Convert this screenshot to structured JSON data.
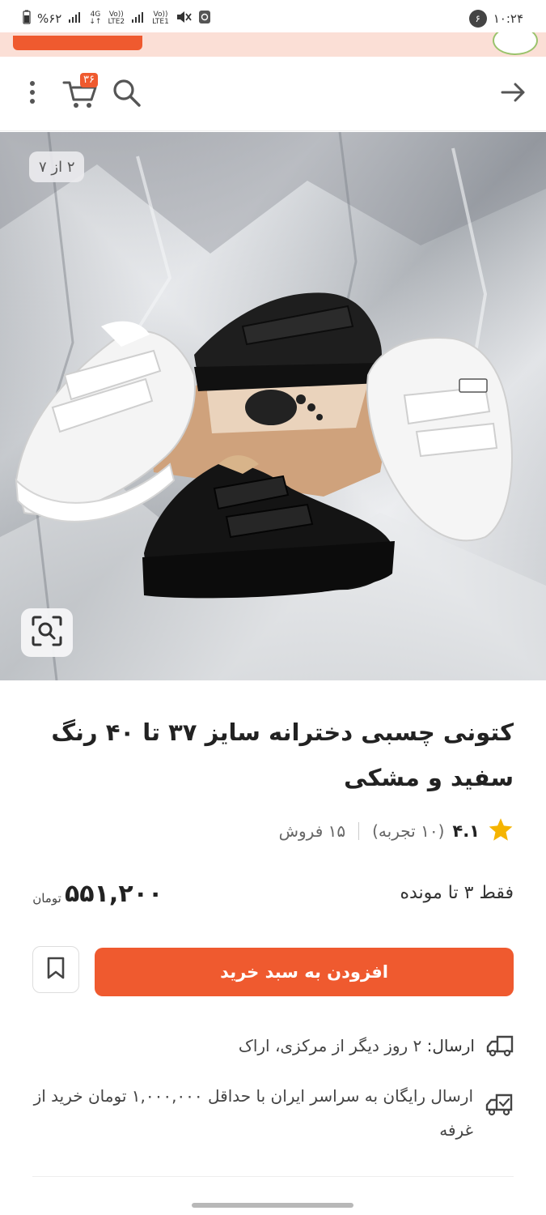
{
  "status_bar": {
    "time": "۱۰:۲۴",
    "notification_count": "۶",
    "battery": "%۶۲",
    "net_4g": "4G",
    "lte2": "LTE2",
    "lte1": "LTE1",
    "volte": "Vo))"
  },
  "gallery": {
    "counter": "۲ از ۷"
  },
  "cart": {
    "count": "۳۶"
  },
  "product": {
    "title": "کتونی چسبی دخترانه سایز ۳۷ تا ۴۰ رنگ سفید و مشکی",
    "rating": "۴.۱",
    "reviews": "(۱۰ تجربه)",
    "sales": "۱۵ فروش",
    "stock": "فقط ۳ تا مونده",
    "price": "۵۵۱,۲۰۰",
    "currency": "تومان"
  },
  "actions": {
    "add_to_cart": "افزودن به سبد خرید"
  },
  "shipping": {
    "label": "ارسال:",
    "detail": "۲ روز دیگر از مرکزی، اراک",
    "free": "ارسال رایگان به سراسر ایران با حداقل ۱,۰۰۰,۰۰۰ تومان خرید از غرفه"
  },
  "colors": {
    "accent": "#ef5a2f",
    "star": "#f5b400"
  }
}
